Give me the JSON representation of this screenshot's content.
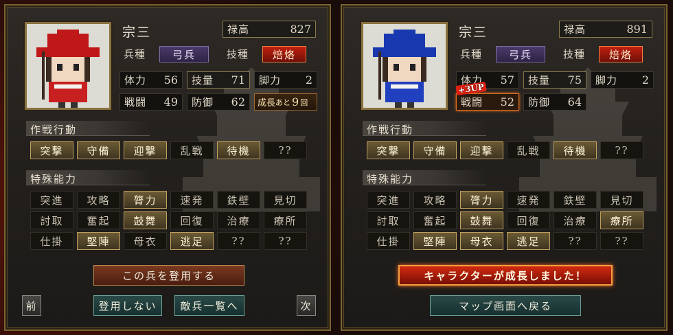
{
  "left": {
    "name": "宗三",
    "stipend_label": "禄高",
    "stipend_value": "827",
    "unit_type_label": "兵種",
    "unit_type_value": "弓兵",
    "skill_label": "技種",
    "skill_value": "焙烙",
    "stats": [
      {
        "label": "体力",
        "value": "56"
      },
      {
        "label": "技量",
        "value": "71"
      },
      {
        "label": "脚力",
        "value": "2"
      },
      {
        "label": "戦闘",
        "value": "49"
      },
      {
        "label": "防御",
        "value": "62"
      }
    ],
    "growth_prefix": "成長",
    "growth_mid": "あと",
    "growth_value": "9",
    "growth_suffix": "回",
    "tactics_title": "作戦行動",
    "tactics": [
      {
        "label": "突撃",
        "on": true
      },
      {
        "label": "守備",
        "on": true
      },
      {
        "label": "迎撃",
        "on": true
      },
      {
        "label": "乱戦",
        "on": false
      },
      {
        "label": "待機",
        "on": true
      },
      {
        "label": "??",
        "on": false
      }
    ],
    "abilities_title": "特殊能力",
    "abilities": [
      {
        "label": "突進",
        "on": false
      },
      {
        "label": "攻略",
        "on": false
      },
      {
        "label": "膂力",
        "on": true
      },
      {
        "label": "速発",
        "on": false
      },
      {
        "label": "鉄壁",
        "on": false
      },
      {
        "label": "見切",
        "on": false
      },
      {
        "label": "討取",
        "on": false
      },
      {
        "label": "奮起",
        "on": false
      },
      {
        "label": "鼓舞",
        "on": true
      },
      {
        "label": "回復",
        "on": false
      },
      {
        "label": "治療",
        "on": false
      },
      {
        "label": "療所",
        "on": false
      },
      {
        "label": "仕掛",
        "on": false
      },
      {
        "label": "堅陣",
        "on": true
      },
      {
        "label": "母衣",
        "on": false
      },
      {
        "label": "逃足",
        "on": true
      },
      {
        "label": "??",
        "on": false
      },
      {
        "label": "??",
        "on": false
      }
    ],
    "recruit_button": "この兵を登用する",
    "prev_button": "前",
    "skip_button": "登用しない",
    "enemy_list_button": "敵兵一覧へ",
    "next_button": "次",
    "hat_color": "#c01818",
    "body_color": "#c82020"
  },
  "right": {
    "name": "宗三",
    "stipend_label": "禄高",
    "stipend_value": "891",
    "unit_type_label": "兵種",
    "unit_type_value": "弓兵",
    "skill_label": "技種",
    "skill_value": "焙烙",
    "stats": [
      {
        "label": "体力",
        "value": "57"
      },
      {
        "label": "技量",
        "value": "75"
      },
      {
        "label": "脚力",
        "value": "2"
      },
      {
        "label": "戦闘",
        "value": "52"
      },
      {
        "label": "防御",
        "value": "64"
      }
    ],
    "up_badge": "+3UP",
    "tactics_title": "作戦行動",
    "tactics": [
      {
        "label": "突撃",
        "on": true
      },
      {
        "label": "守備",
        "on": true
      },
      {
        "label": "迎撃",
        "on": true
      },
      {
        "label": "乱戦",
        "on": false
      },
      {
        "label": "待機",
        "on": true
      },
      {
        "label": "??",
        "on": false
      }
    ],
    "abilities_title": "特殊能力",
    "abilities": [
      {
        "label": "突進",
        "on": false
      },
      {
        "label": "攻略",
        "on": false
      },
      {
        "label": "膂力",
        "on": true
      },
      {
        "label": "速発",
        "on": false
      },
      {
        "label": "鉄壁",
        "on": false
      },
      {
        "label": "見切",
        "on": false
      },
      {
        "label": "討取",
        "on": false
      },
      {
        "label": "奮起",
        "on": false
      },
      {
        "label": "鼓舞",
        "on": true
      },
      {
        "label": "回復",
        "on": false
      },
      {
        "label": "治療",
        "on": false
      },
      {
        "label": "療所",
        "on": true
      },
      {
        "label": "仕掛",
        "on": false
      },
      {
        "label": "堅陣",
        "on": true
      },
      {
        "label": "母衣",
        "on": true
      },
      {
        "label": "逃足",
        "on": true
      },
      {
        "label": "??",
        "on": false
      },
      {
        "label": "??",
        "on": false
      }
    ],
    "growth_banner": "キャラクターが成長しました！",
    "map_button": "マップ画面へ戻る",
    "hat_color": "#1838b0",
    "body_color": "#2040c0"
  },
  "colors": {
    "frame_gold": "#7a6330",
    "active_cell": "#6a5a34",
    "growth_highlight": "#e07020"
  }
}
